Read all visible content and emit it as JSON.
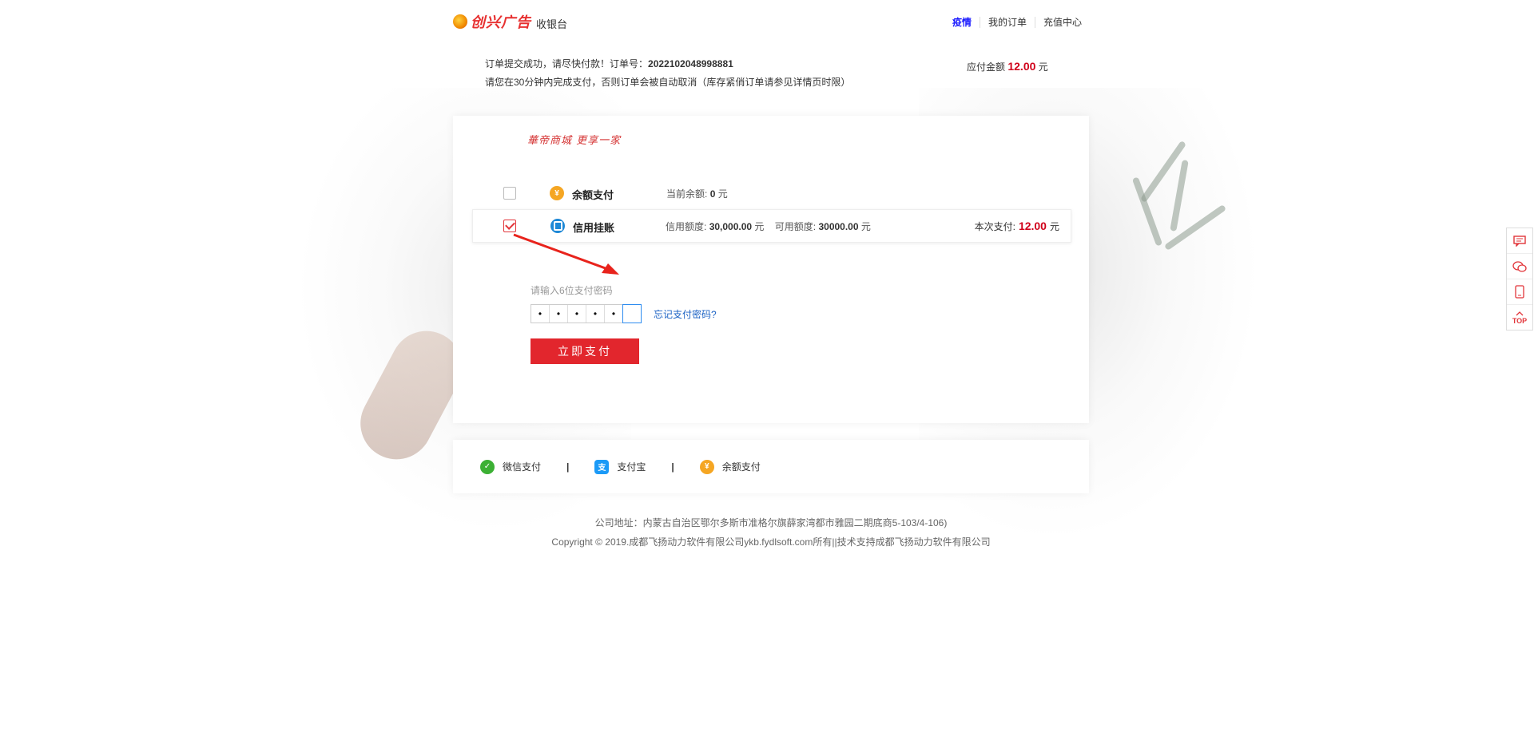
{
  "header": {
    "logo_text": "创兴广告",
    "subtitle": "收银台",
    "nav": [
      "疫情",
      "我的订单",
      "充值中心"
    ]
  },
  "order": {
    "line1_prefix": "订单提交成功，请尽快付款！订单号：",
    "order_no": "2022102048998881",
    "line2": "请您在30分钟内完成支付，否则订单会被自动取消（库存紧俏订单请参见详情页时限）",
    "amount_label": "应付金额",
    "amount": "12.00",
    "amount_unit": "元"
  },
  "card": {
    "slogan": "華帝商城 更享一家",
    "balance": {
      "name": "余额支付",
      "checked": false,
      "detail_label": "当前余额:",
      "detail_value": "0",
      "detail_unit": "元"
    },
    "credit": {
      "name": "信用挂账",
      "checked": true,
      "limit_label": "信用额度:",
      "limit_value": "30,000.00",
      "limit_unit": "元",
      "avail_label": "可用额度:",
      "avail_value": "30000.00",
      "avail_unit": "元",
      "this_label": "本次支付:",
      "this_value": "12.00",
      "this_unit": "元"
    },
    "password_label": "请输入6位支付密码",
    "password_cells": [
      "•",
      "•",
      "•",
      "•",
      "•",
      ""
    ],
    "forgot": "忘记支付密码?",
    "pay_button": "立即支付"
  },
  "methods": [
    "微信支付",
    "支付宝",
    "余额支付"
  ],
  "separator": "|",
  "footer": {
    "address": "公司地址：内蒙古自治区鄂尔多斯市准格尔旗薛家湾都市雅园二期底商5-103/4-106)",
    "copyright": "Copyright © 2019.成都飞扬动力软件有限公司ykb.fydlsoft.com所有||技术支持成都飞扬动力软件有限公司"
  },
  "side_tools": [
    "message-icon",
    "wechat-icon",
    "mobile-icon",
    "TOP"
  ],
  "colors": {
    "accent": "#e2262d",
    "price": "#d0021b",
    "link": "#1b62c4"
  }
}
